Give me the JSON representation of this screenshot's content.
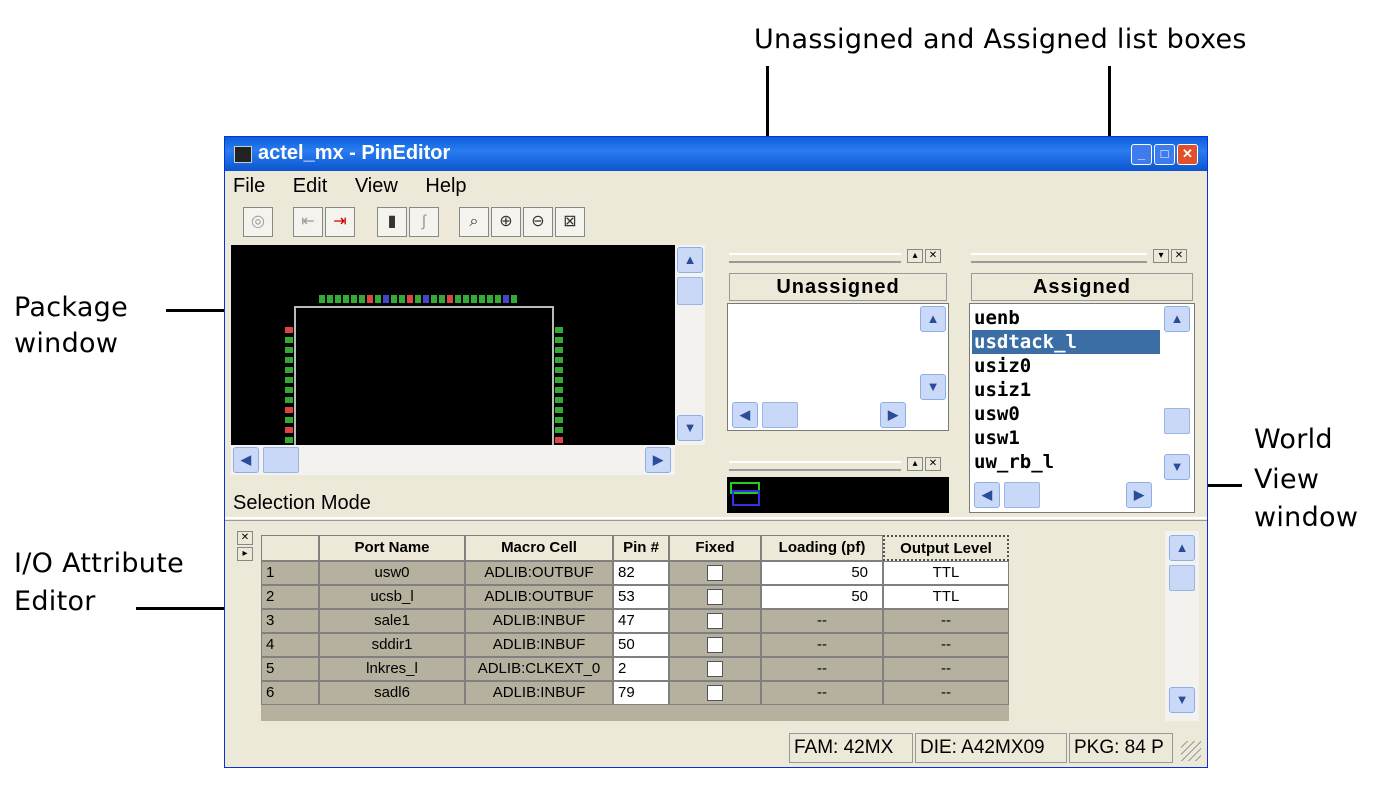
{
  "callouts": {
    "list_boxes": "Unassigned and Assigned list boxes",
    "package_line1": "Package",
    "package_line2": "window",
    "io_line1": "I/O Attribute",
    "io_line2": "Editor",
    "world_line1": "World",
    "world_line2": "View",
    "world_line3": "window"
  },
  "window": {
    "title": "actel_mx - PinEditor",
    "minimize_icon": "minimize-icon",
    "maximize_icon": "maximize-icon",
    "close_icon": "close-icon"
  },
  "menu": [
    "File",
    "Edit",
    "View",
    "Help"
  ],
  "toolbar_icons": [
    "database-icon",
    "import-icon",
    "export-icon",
    "lock-icon",
    "unlock-icon",
    "zoom-select-icon",
    "zoom-in-icon",
    "zoom-out-icon",
    "zoom-fit-icon"
  ],
  "panels": {
    "unassigned_title": "Unassigned",
    "assigned_title": "Assigned",
    "assigned_items": [
      "uenb",
      "usdtack_l",
      "usiz0",
      "usiz1",
      "usw0",
      "usw1",
      "uw_rb_l"
    ],
    "assigned_selected": "usdtack_l"
  },
  "status_mode": "Selection Mode",
  "table": {
    "columns": [
      "",
      "Port Name",
      "Macro Cell",
      "Pin #",
      "Fixed",
      "Loading (pf)",
      "Output Level"
    ],
    "rows": [
      {
        "n": "1",
        "port": "usw0",
        "macro": "ADLIB:OUTBUF",
        "pin": "82",
        "loading": "50",
        "level": "TTL"
      },
      {
        "n": "2",
        "port": "ucsb_l",
        "macro": "ADLIB:OUTBUF",
        "pin": "53",
        "loading": "50",
        "level": "TTL"
      },
      {
        "n": "3",
        "port": "sale1",
        "macro": "ADLIB:INBUF",
        "pin": "47",
        "loading": "--",
        "level": "--"
      },
      {
        "n": "4",
        "port": "sddir1",
        "macro": "ADLIB:INBUF",
        "pin": "50",
        "loading": "--",
        "level": "--"
      },
      {
        "n": "5",
        "port": "lnkres_l",
        "macro": "ADLIB:CLKEXT_0",
        "pin": "2",
        "loading": "--",
        "level": "--"
      },
      {
        "n": "6",
        "port": "sadl6",
        "macro": "ADLIB:INBUF",
        "pin": "79",
        "loading": "--",
        "level": "--"
      }
    ]
  },
  "statusbar": {
    "fam": "FAM: 42MX",
    "die": "DIE: A42MX09",
    "pkg": "PKG: 84 P"
  }
}
